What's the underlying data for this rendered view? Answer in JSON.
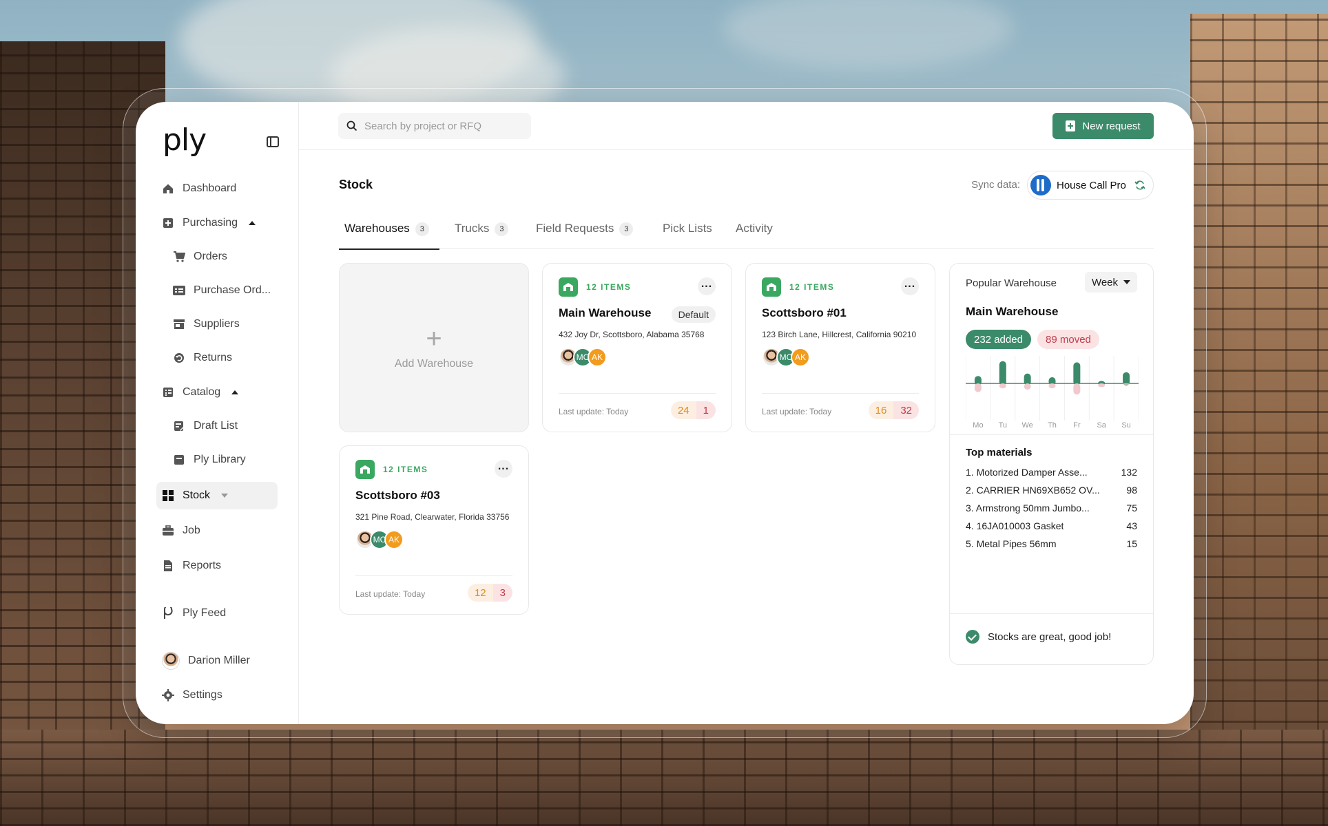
{
  "app": {
    "logo": "ply"
  },
  "sidebar": {
    "items": [
      {
        "label": "Dashboard"
      },
      {
        "label": "Purchasing"
      },
      {
        "label": "Orders"
      },
      {
        "label": "Purchase Ord..."
      },
      {
        "label": "Suppliers"
      },
      {
        "label": "Returns"
      },
      {
        "label": "Catalog"
      },
      {
        "label": "Draft List"
      },
      {
        "label": "Ply Library"
      },
      {
        "label": "Stock"
      },
      {
        "label": "Job"
      },
      {
        "label": "Reports"
      },
      {
        "label": "Ply Feed"
      }
    ],
    "user": {
      "name": "Darion Miller"
    },
    "settings": "Settings"
  },
  "topbar": {
    "search_placeholder": "Search by project or RFQ",
    "new_request": "New request"
  },
  "page": {
    "title": "Stock",
    "sync_label": "Sync data:",
    "sync_provider": "House Call Pro"
  },
  "tabs": [
    {
      "label": "Warehouses",
      "count": "3"
    },
    {
      "label": "Trucks",
      "count": "3"
    },
    {
      "label": "Field Requests",
      "count": "3"
    },
    {
      "label": "Pick Lists"
    },
    {
      "label": "Activity"
    }
  ],
  "add_warehouse": {
    "plus": "+",
    "label": "Add Warehouse"
  },
  "warehouses": [
    {
      "items": "12 ITEMS",
      "name": "Main Warehouse",
      "badge": "Default",
      "address": "432 Joy Dr, Scottsboro, Alabama 35768",
      "avatars": [
        "MC",
        "AK"
      ],
      "last_update": "Last update: Today",
      "stat_a": "24",
      "stat_b": "1"
    },
    {
      "items": "12 ITEMS",
      "name": "Scottsboro #01",
      "address": "123 Birch Lane, Hillcrest, California 90210",
      "avatars": [
        "MC",
        "AK"
      ],
      "last_update": "Last update: Today",
      "stat_a": "16",
      "stat_b": "32"
    },
    {
      "items": "12 ITEMS",
      "name": "Scottsboro #03",
      "address": "321 Pine Road, Clearwater, Florida 33756",
      "avatars": [
        "MC",
        "AK"
      ],
      "last_update": "Last update: Today",
      "stat_a": "12",
      "stat_b": "3"
    }
  ],
  "popular": {
    "title": "Popular Warehouse",
    "period": "Week",
    "warehouse": "Main Warehouse",
    "added": "232  added",
    "moved": "89  moved",
    "top_title": "Top materials",
    "materials": [
      {
        "name": "1. Motorized Damper Asse...",
        "qty": "132"
      },
      {
        "name": "2. CARRIER HN69XB652 OV...",
        "qty": "98"
      },
      {
        "name": "3. Armstrong 50mm Jumbo...",
        "qty": "75"
      },
      {
        "name": "4. 16JA010003 Gasket",
        "qty": "43"
      },
      {
        "name": "5. Metal Pipes 56mm",
        "qty": "15"
      }
    ],
    "footer": "Stocks are great, good job!"
  },
  "chart_data": {
    "type": "bar",
    "categories": [
      "Mo",
      "Tu",
      "We",
      "Th",
      "Fr",
      "Sa",
      "Su"
    ],
    "series": [
      {
        "values": [
          0.3,
          0.9,
          0.4,
          0.25,
          0.85,
          0.1,
          0.45
        ]
      },
      {
        "values": [
          -0.35,
          -0.2,
          -0.25,
          -0.2,
          -0.45,
          -0.15,
          -0.05
        ]
      }
    ],
    "colors": {
      "added": "#3b8b6b",
      "moved": "#f1c9cc"
    }
  }
}
